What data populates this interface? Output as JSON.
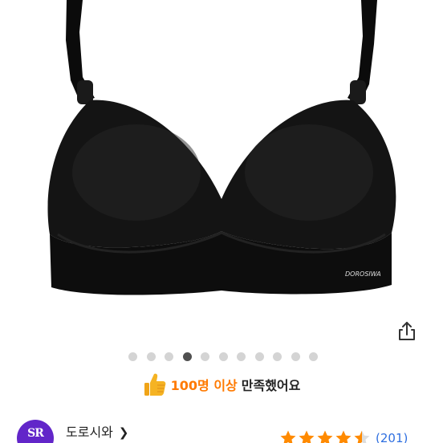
{
  "product": {
    "image_alt": "black wireless push-up bra",
    "brand_tag": "DOROSIWA"
  },
  "actions": {
    "share_icon": "share-icon"
  },
  "carousel": {
    "total": 11,
    "active_index": 3
  },
  "satisfaction": {
    "icon": "thumbs-up-icon",
    "highlight": "100명 이상",
    "rest": "만족했어요"
  },
  "seller": {
    "avatar_text": "SR",
    "name": "도로시와",
    "chevron": "❯"
  },
  "rating": {
    "value": 4.5,
    "max": 5,
    "review_count": "(201)"
  },
  "colors": {
    "accent": "#ff7a00",
    "star": "#ff8a00",
    "link": "#2f6fe0",
    "avatar_bg": "#6226c9",
    "dot": "#d4d4d4",
    "dot_active": "#505050"
  }
}
